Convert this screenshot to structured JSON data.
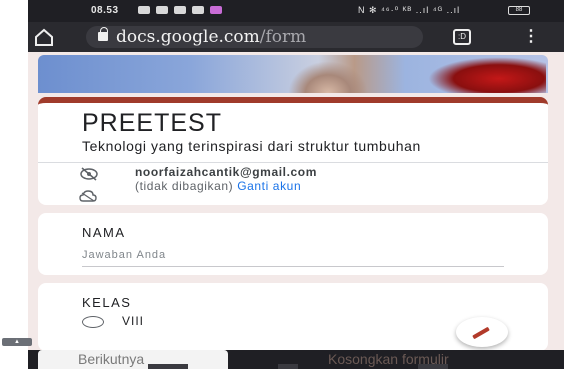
{
  "status_bar": {
    "time": "08.53",
    "right_text": "N ✻ ⁴⁶·⁰ ᴷᴮ ..ıl ⁴ᴳ ..ıl",
    "battery": "88"
  },
  "browser": {
    "url_main": "docs.google.com",
    "url_rest": "/form",
    "tabs_label": ":D"
  },
  "form": {
    "title": "PREETEST",
    "description": "Teknologi yang terinspirasi dari struktur tumbuhan",
    "email": "noorfaizahcantik@gmail.com",
    "not_shared": "(tidak dibagikan)",
    "switch_account": "Ganti akun"
  },
  "questions": [
    {
      "label": "NAMA",
      "placeholder": "Jawaban Anda"
    },
    {
      "label": "KELAS",
      "options": [
        "VIII"
      ]
    }
  ],
  "bottom": {
    "prev_label": "Berikutnya",
    "clear_label": "Kosongkan formulir"
  },
  "colors": {
    "accent": "#a03b2b",
    "link": "#1a73e8"
  }
}
